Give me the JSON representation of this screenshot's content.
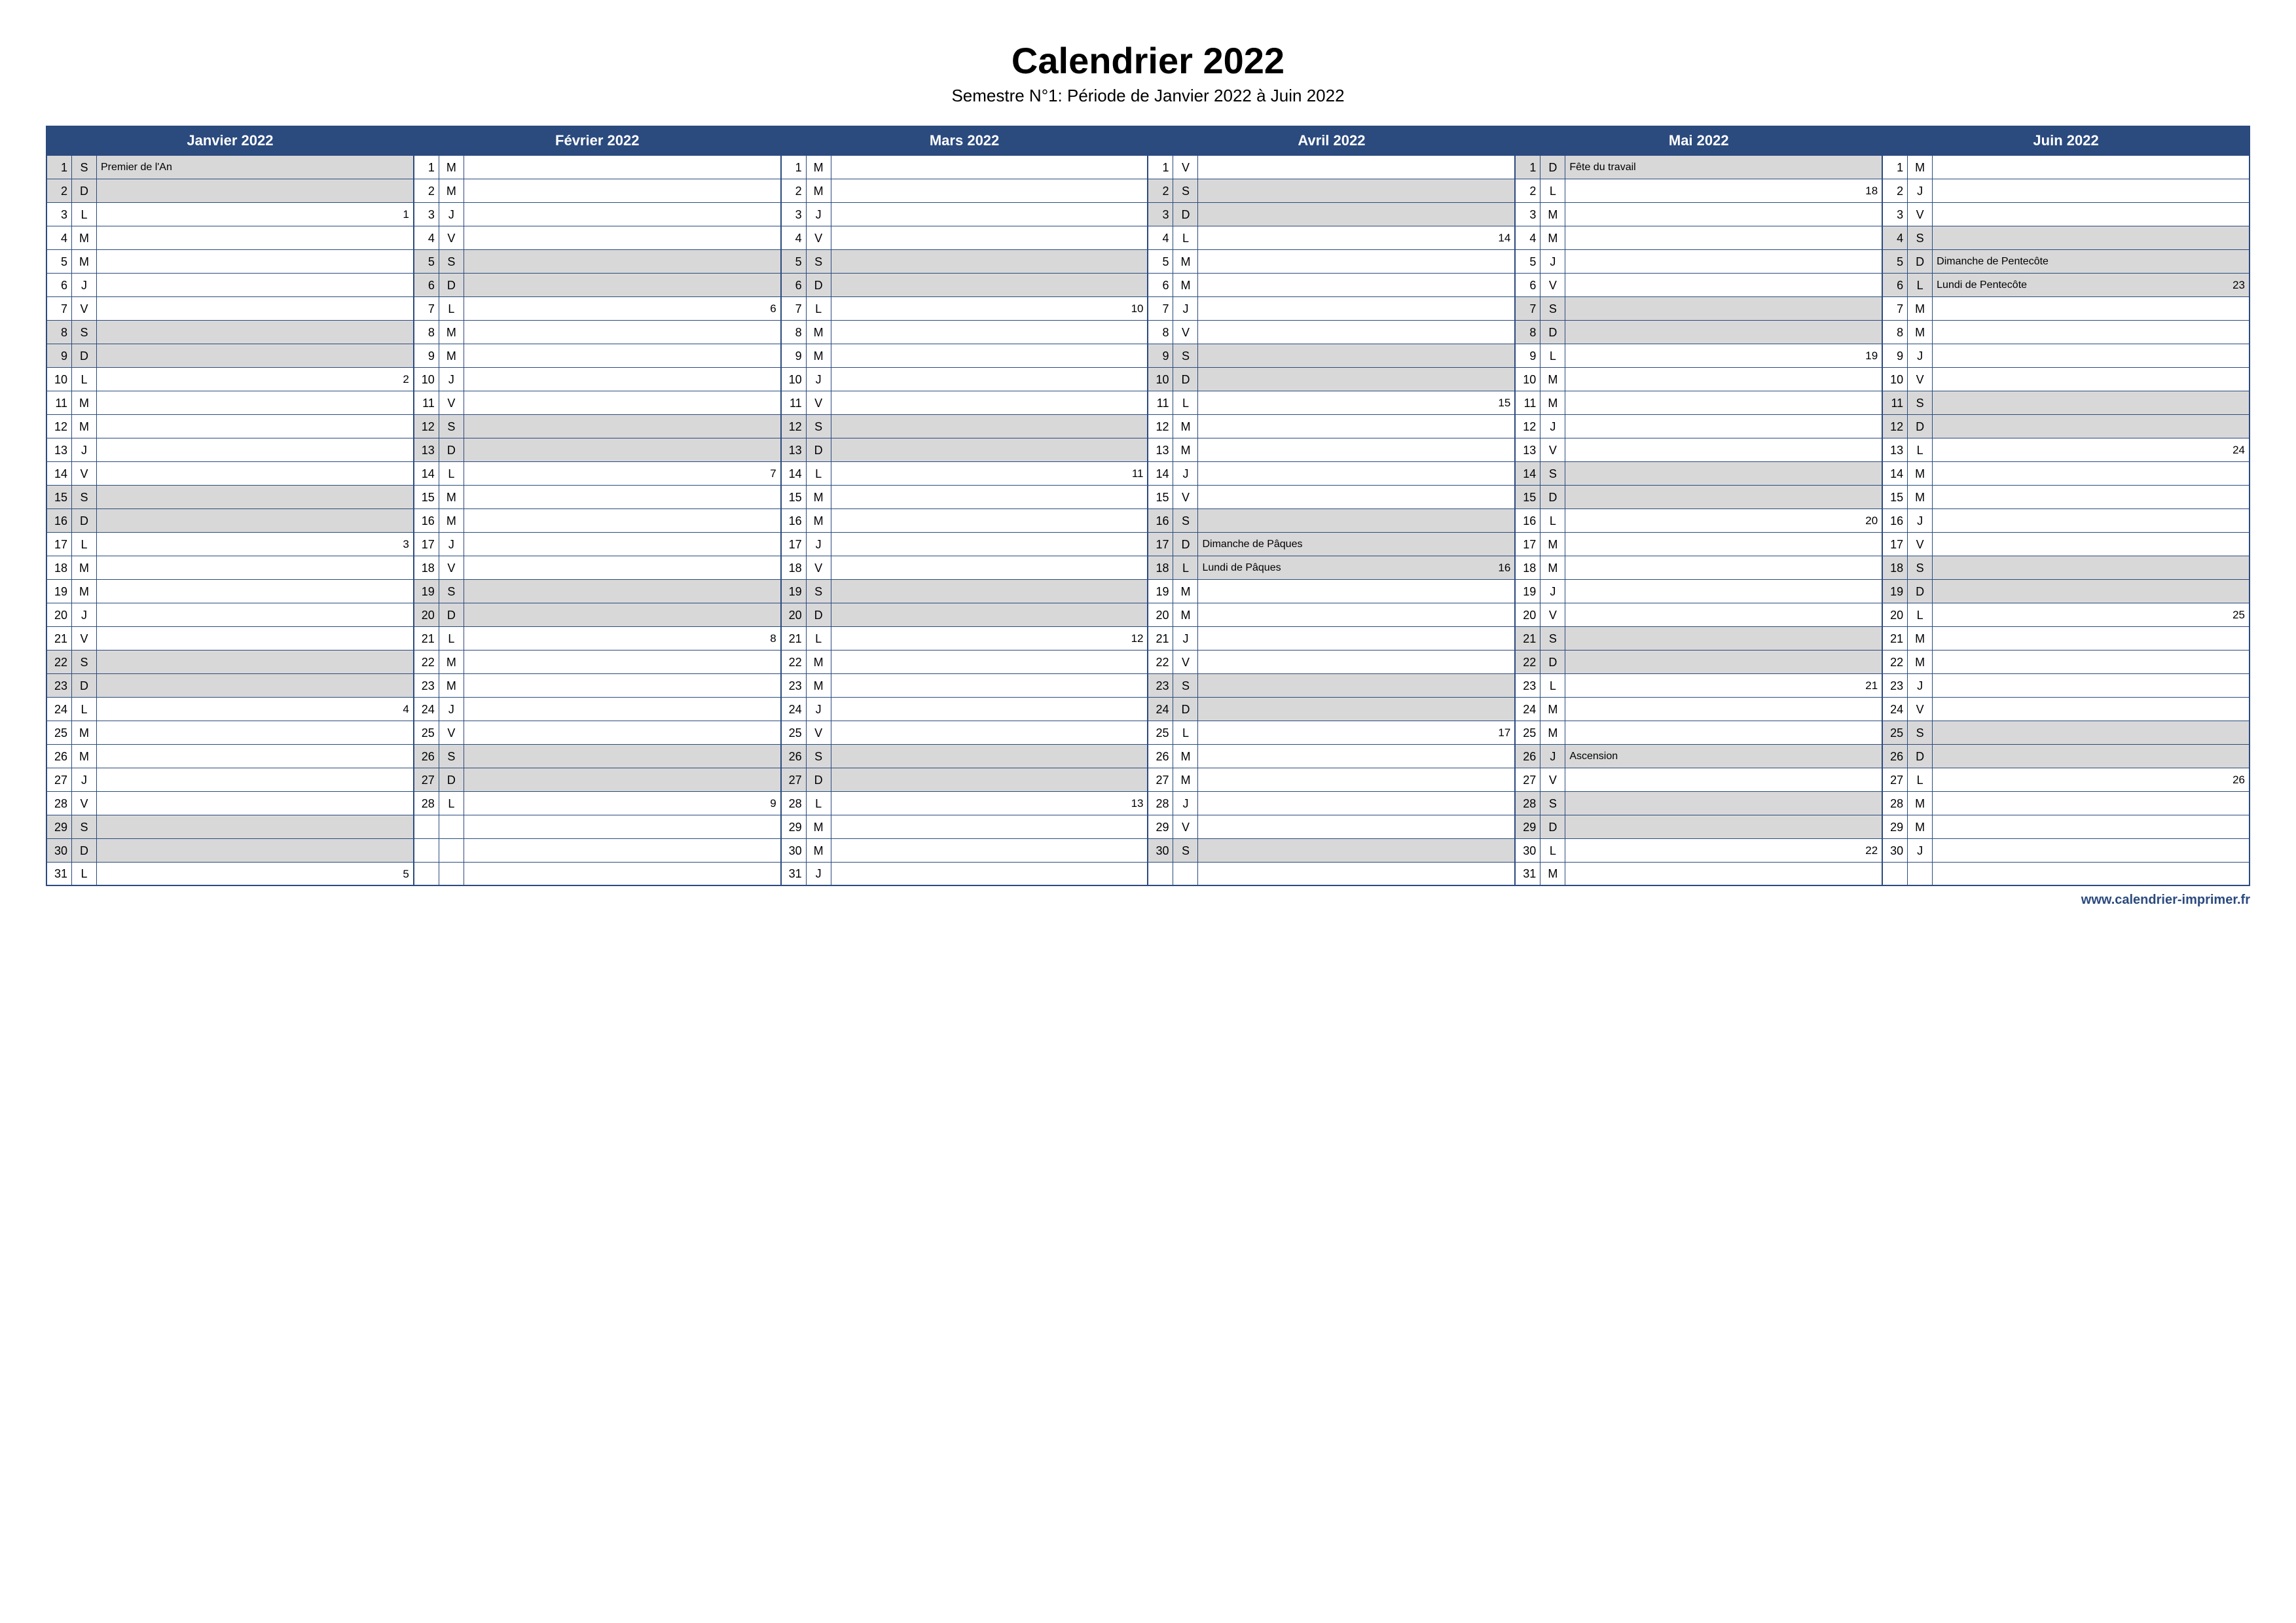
{
  "title": "Calendrier 2022",
  "subtitle": "Semestre N°1: Période de Janvier 2022 à Juin 2022",
  "footer": "www.calendrier-imprimer.fr",
  "months": [
    {
      "name": "Janvier 2022",
      "days": [
        {
          "n": 1,
          "d": "S",
          "event": "Premier de l'An",
          "shaded": true
        },
        {
          "n": 2,
          "d": "D",
          "shaded": true
        },
        {
          "n": 3,
          "d": "L",
          "week": 1
        },
        {
          "n": 4,
          "d": "M"
        },
        {
          "n": 5,
          "d": "M"
        },
        {
          "n": 6,
          "d": "J"
        },
        {
          "n": 7,
          "d": "V"
        },
        {
          "n": 8,
          "d": "S",
          "shaded": true
        },
        {
          "n": 9,
          "d": "D",
          "shaded": true
        },
        {
          "n": 10,
          "d": "L",
          "week": 2
        },
        {
          "n": 11,
          "d": "M"
        },
        {
          "n": 12,
          "d": "M"
        },
        {
          "n": 13,
          "d": "J"
        },
        {
          "n": 14,
          "d": "V"
        },
        {
          "n": 15,
          "d": "S",
          "shaded": true
        },
        {
          "n": 16,
          "d": "D",
          "shaded": true
        },
        {
          "n": 17,
          "d": "L",
          "week": 3
        },
        {
          "n": 18,
          "d": "M"
        },
        {
          "n": 19,
          "d": "M"
        },
        {
          "n": 20,
          "d": "J"
        },
        {
          "n": 21,
          "d": "V"
        },
        {
          "n": 22,
          "d": "S",
          "shaded": true
        },
        {
          "n": 23,
          "d": "D",
          "shaded": true
        },
        {
          "n": 24,
          "d": "L",
          "week": 4
        },
        {
          "n": 25,
          "d": "M"
        },
        {
          "n": 26,
          "d": "M"
        },
        {
          "n": 27,
          "d": "J"
        },
        {
          "n": 28,
          "d": "V"
        },
        {
          "n": 29,
          "d": "S",
          "shaded": true
        },
        {
          "n": 30,
          "d": "D",
          "shaded": true
        },
        {
          "n": 31,
          "d": "L",
          "week": 5
        }
      ]
    },
    {
      "name": "Février 2022",
      "days": [
        {
          "n": 1,
          "d": "M"
        },
        {
          "n": 2,
          "d": "M"
        },
        {
          "n": 3,
          "d": "J"
        },
        {
          "n": 4,
          "d": "V"
        },
        {
          "n": 5,
          "d": "S",
          "shaded": true
        },
        {
          "n": 6,
          "d": "D",
          "shaded": true
        },
        {
          "n": 7,
          "d": "L",
          "week": 6
        },
        {
          "n": 8,
          "d": "M"
        },
        {
          "n": 9,
          "d": "M"
        },
        {
          "n": 10,
          "d": "J"
        },
        {
          "n": 11,
          "d": "V"
        },
        {
          "n": 12,
          "d": "S",
          "shaded": true
        },
        {
          "n": 13,
          "d": "D",
          "shaded": true
        },
        {
          "n": 14,
          "d": "L",
          "week": 7
        },
        {
          "n": 15,
          "d": "M"
        },
        {
          "n": 16,
          "d": "M"
        },
        {
          "n": 17,
          "d": "J"
        },
        {
          "n": 18,
          "d": "V"
        },
        {
          "n": 19,
          "d": "S",
          "shaded": true
        },
        {
          "n": 20,
          "d": "D",
          "shaded": true
        },
        {
          "n": 21,
          "d": "L",
          "week": 8
        },
        {
          "n": 22,
          "d": "M"
        },
        {
          "n": 23,
          "d": "M"
        },
        {
          "n": 24,
          "d": "J"
        },
        {
          "n": 25,
          "d": "V"
        },
        {
          "n": 26,
          "d": "S",
          "shaded": true
        },
        {
          "n": 27,
          "d": "D",
          "shaded": true
        },
        {
          "n": 28,
          "d": "L",
          "week": 9
        },
        {
          "empty": true
        },
        {
          "empty": true
        },
        {
          "empty": true
        }
      ]
    },
    {
      "name": "Mars 2022",
      "days": [
        {
          "n": 1,
          "d": "M"
        },
        {
          "n": 2,
          "d": "M"
        },
        {
          "n": 3,
          "d": "J"
        },
        {
          "n": 4,
          "d": "V"
        },
        {
          "n": 5,
          "d": "S",
          "shaded": true
        },
        {
          "n": 6,
          "d": "D",
          "shaded": true
        },
        {
          "n": 7,
          "d": "L",
          "week": 10
        },
        {
          "n": 8,
          "d": "M"
        },
        {
          "n": 9,
          "d": "M"
        },
        {
          "n": 10,
          "d": "J"
        },
        {
          "n": 11,
          "d": "V"
        },
        {
          "n": 12,
          "d": "S",
          "shaded": true
        },
        {
          "n": 13,
          "d": "D",
          "shaded": true
        },
        {
          "n": 14,
          "d": "L",
          "week": 11
        },
        {
          "n": 15,
          "d": "M"
        },
        {
          "n": 16,
          "d": "M"
        },
        {
          "n": 17,
          "d": "J"
        },
        {
          "n": 18,
          "d": "V"
        },
        {
          "n": 19,
          "d": "S",
          "shaded": true
        },
        {
          "n": 20,
          "d": "D",
          "shaded": true
        },
        {
          "n": 21,
          "d": "L",
          "week": 12
        },
        {
          "n": 22,
          "d": "M"
        },
        {
          "n": 23,
          "d": "M"
        },
        {
          "n": 24,
          "d": "J"
        },
        {
          "n": 25,
          "d": "V"
        },
        {
          "n": 26,
          "d": "S",
          "shaded": true
        },
        {
          "n": 27,
          "d": "D",
          "shaded": true
        },
        {
          "n": 28,
          "d": "L",
          "week": 13
        },
        {
          "n": 29,
          "d": "M"
        },
        {
          "n": 30,
          "d": "M"
        },
        {
          "n": 31,
          "d": "J"
        }
      ]
    },
    {
      "name": "Avril 2022",
      "days": [
        {
          "n": 1,
          "d": "V"
        },
        {
          "n": 2,
          "d": "S",
          "shaded": true
        },
        {
          "n": 3,
          "d": "D",
          "shaded": true
        },
        {
          "n": 4,
          "d": "L",
          "week": 14
        },
        {
          "n": 5,
          "d": "M"
        },
        {
          "n": 6,
          "d": "M"
        },
        {
          "n": 7,
          "d": "J"
        },
        {
          "n": 8,
          "d": "V"
        },
        {
          "n": 9,
          "d": "S",
          "shaded": true
        },
        {
          "n": 10,
          "d": "D",
          "shaded": true
        },
        {
          "n": 11,
          "d": "L",
          "week": 15
        },
        {
          "n": 12,
          "d": "M"
        },
        {
          "n": 13,
          "d": "M"
        },
        {
          "n": 14,
          "d": "J"
        },
        {
          "n": 15,
          "d": "V"
        },
        {
          "n": 16,
          "d": "S",
          "shaded": true
        },
        {
          "n": 17,
          "d": "D",
          "event": "Dimanche de Pâques",
          "shaded": true
        },
        {
          "n": 18,
          "d": "L",
          "event": "Lundi de Pâques",
          "week": 16,
          "shaded": true
        },
        {
          "n": 19,
          "d": "M"
        },
        {
          "n": 20,
          "d": "M"
        },
        {
          "n": 21,
          "d": "J"
        },
        {
          "n": 22,
          "d": "V"
        },
        {
          "n": 23,
          "d": "S",
          "shaded": true
        },
        {
          "n": 24,
          "d": "D",
          "shaded": true
        },
        {
          "n": 25,
          "d": "L",
          "week": 17
        },
        {
          "n": 26,
          "d": "M"
        },
        {
          "n": 27,
          "d": "M"
        },
        {
          "n": 28,
          "d": "J"
        },
        {
          "n": 29,
          "d": "V"
        },
        {
          "n": 30,
          "d": "S",
          "shaded": true
        },
        {
          "empty": true
        }
      ]
    },
    {
      "name": "Mai 2022",
      "days": [
        {
          "n": 1,
          "d": "D",
          "event": "Fête du travail",
          "shaded": true
        },
        {
          "n": 2,
          "d": "L",
          "week": 18
        },
        {
          "n": 3,
          "d": "M"
        },
        {
          "n": 4,
          "d": "M"
        },
        {
          "n": 5,
          "d": "J"
        },
        {
          "n": 6,
          "d": "V"
        },
        {
          "n": 7,
          "d": "S",
          "shaded": true
        },
        {
          "n": 8,
          "d": "D",
          "shaded": true
        },
        {
          "n": 9,
          "d": "L",
          "week": 19
        },
        {
          "n": 10,
          "d": "M"
        },
        {
          "n": 11,
          "d": "M"
        },
        {
          "n": 12,
          "d": "J"
        },
        {
          "n": 13,
          "d": "V"
        },
        {
          "n": 14,
          "d": "S",
          "shaded": true
        },
        {
          "n": 15,
          "d": "D",
          "shaded": true
        },
        {
          "n": 16,
          "d": "L",
          "week": 20
        },
        {
          "n": 17,
          "d": "M"
        },
        {
          "n": 18,
          "d": "M"
        },
        {
          "n": 19,
          "d": "J"
        },
        {
          "n": 20,
          "d": "V"
        },
        {
          "n": 21,
          "d": "S",
          "shaded": true
        },
        {
          "n": 22,
          "d": "D",
          "shaded": true
        },
        {
          "n": 23,
          "d": "L",
          "week": 21
        },
        {
          "n": 24,
          "d": "M"
        },
        {
          "n": 25,
          "d": "M"
        },
        {
          "n": 26,
          "d": "J",
          "event": "Ascension",
          "shaded": true
        },
        {
          "n": 27,
          "d": "V"
        },
        {
          "n": 28,
          "d": "S",
          "shaded": true
        },
        {
          "n": 29,
          "d": "D",
          "shaded": true
        },
        {
          "n": 30,
          "d": "L",
          "week": 22
        },
        {
          "n": 31,
          "d": "M"
        }
      ]
    },
    {
      "name": "Juin 2022",
      "days": [
        {
          "n": 1,
          "d": "M"
        },
        {
          "n": 2,
          "d": "J"
        },
        {
          "n": 3,
          "d": "V"
        },
        {
          "n": 4,
          "d": "S",
          "shaded": true
        },
        {
          "n": 5,
          "d": "D",
          "event": "Dimanche de Pentecôte",
          "shaded": true
        },
        {
          "n": 6,
          "d": "L",
          "event": "Lundi de Pentecôte",
          "week": 23,
          "shaded": true
        },
        {
          "n": 7,
          "d": "M"
        },
        {
          "n": 8,
          "d": "M"
        },
        {
          "n": 9,
          "d": "J"
        },
        {
          "n": 10,
          "d": "V"
        },
        {
          "n": 11,
          "d": "S",
          "shaded": true
        },
        {
          "n": 12,
          "d": "D",
          "shaded": true
        },
        {
          "n": 13,
          "d": "L",
          "week": 24
        },
        {
          "n": 14,
          "d": "M"
        },
        {
          "n": 15,
          "d": "M"
        },
        {
          "n": 16,
          "d": "J"
        },
        {
          "n": 17,
          "d": "V"
        },
        {
          "n": 18,
          "d": "S",
          "shaded": true
        },
        {
          "n": 19,
          "d": "D",
          "shaded": true
        },
        {
          "n": 20,
          "d": "L",
          "week": 25
        },
        {
          "n": 21,
          "d": "M"
        },
        {
          "n": 22,
          "d": "M"
        },
        {
          "n": 23,
          "d": "J"
        },
        {
          "n": 24,
          "d": "V"
        },
        {
          "n": 25,
          "d": "S",
          "shaded": true
        },
        {
          "n": 26,
          "d": "D",
          "shaded": true
        },
        {
          "n": 27,
          "d": "L",
          "week": 26
        },
        {
          "n": 28,
          "d": "M"
        },
        {
          "n": 29,
          "d": "M"
        },
        {
          "n": 30,
          "d": "J"
        },
        {
          "empty": true
        }
      ]
    }
  ]
}
